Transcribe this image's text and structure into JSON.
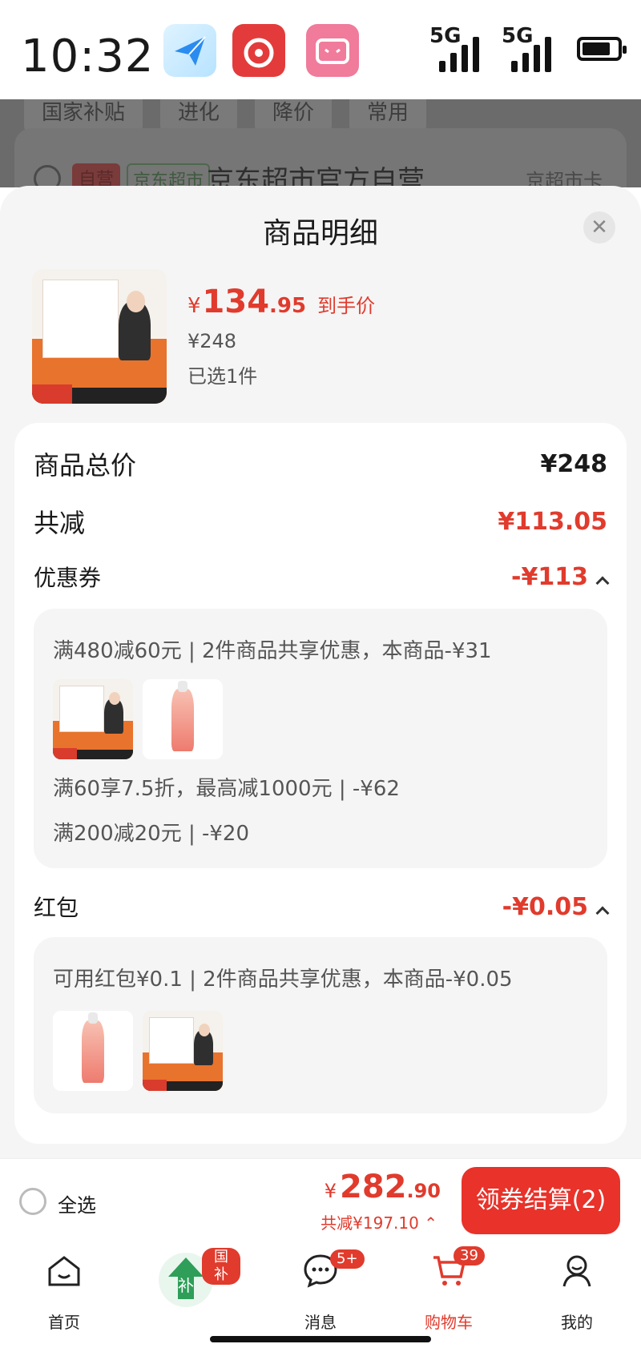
{
  "status_bar": {
    "time": "10:32",
    "net1": "5G",
    "net2": "5G",
    "battery_level": 0.8
  },
  "background": {
    "chips": [
      "国家补贴",
      "进化",
      "降价",
      "常用"
    ],
    "tag_self": "自营",
    "tag_market": "京东超市",
    "store": "京东超市官方自营",
    "right_text": "京超市卡"
  },
  "sheet": {
    "title": "商品明细",
    "product": {
      "price_symbol": "¥",
      "price_int": "134",
      "price_dec": ".95",
      "price_label": "到手价",
      "orig_price": "¥248",
      "selected": "已选1件"
    },
    "rows": {
      "total_label": "商品总价",
      "total_value": "¥248",
      "reduce_label": "共减",
      "reduce_value": "¥113.05",
      "coupon_label": "优惠券",
      "coupon_value": "-¥113",
      "redpacket_label": "红包",
      "redpacket_value": "-¥0.05"
    },
    "coupon_lines": [
      "满480减60元 | 2件商品共享优惠，本商品-¥31",
      "满60享7.5折，最高减1000元 | -¥62",
      "满200减20元 | -¥20"
    ],
    "redpacket_line": "可用红包¥0.1 | 2件商品共享优惠，本商品-¥0.05"
  },
  "action_bar": {
    "select_all": "全选",
    "total_symbol": "¥",
    "total_int": "282",
    "total_dec": ".90",
    "saved": "共减¥197.10",
    "checkout": "领券结算(2)"
  },
  "tabs": [
    {
      "label": "首页"
    },
    {
      "badge": "国补"
    },
    {
      "label": "消息",
      "badge": "5+"
    },
    {
      "label": "购物车",
      "badge": "39"
    },
    {
      "label": "我的"
    }
  ],
  "colors": {
    "accent": "#e03b2d",
    "checkout": "#e8322a",
    "panel": "#f5f5f5"
  }
}
